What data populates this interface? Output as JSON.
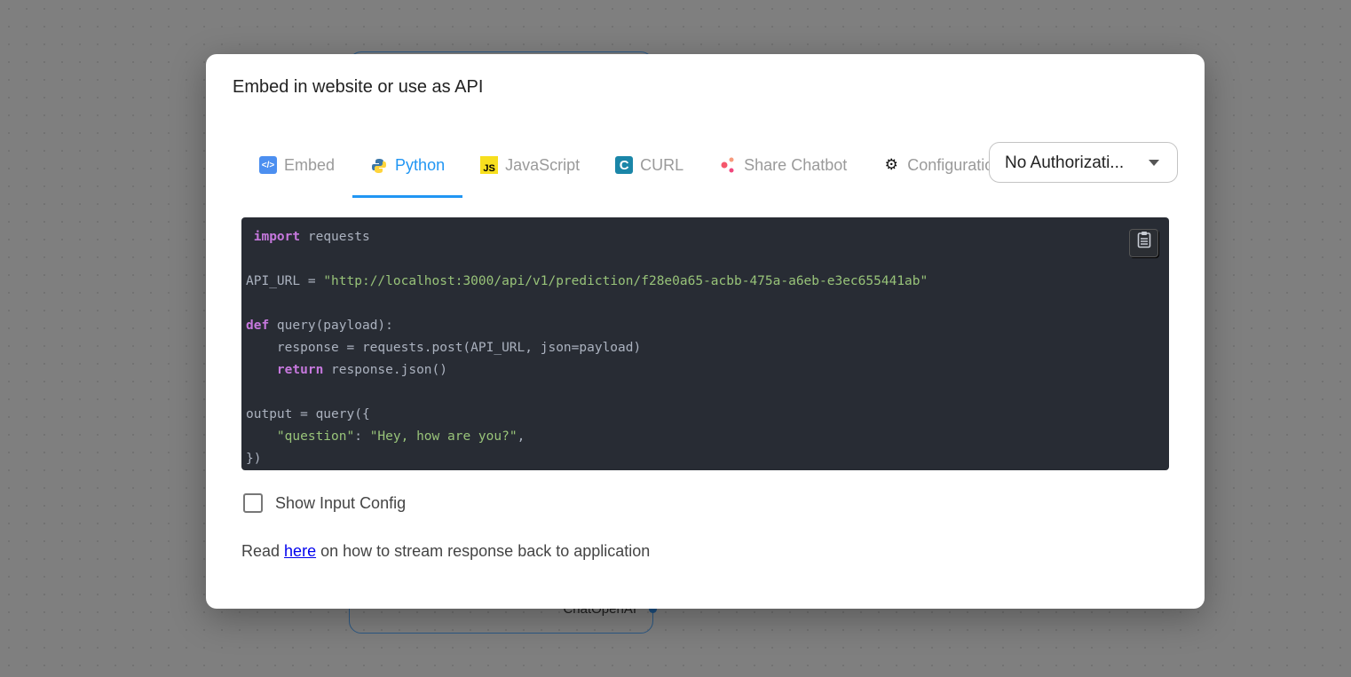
{
  "background": {
    "node_label": "ChatOpenAI"
  },
  "modal": {
    "title": "Embed in website or use as API",
    "tabs": [
      {
        "label": "Embed",
        "icon": "code-icon"
      },
      {
        "label": "Python",
        "icon": "python-icon"
      },
      {
        "label": "JavaScript",
        "icon": "js-icon"
      },
      {
        "label": "CURL",
        "icon": "curl-icon"
      },
      {
        "label": "Share Chatbot",
        "icon": "share-icon"
      },
      {
        "label": "Configuration",
        "icon": "gear-icon"
      }
    ],
    "active_tab": "Python",
    "auth_select": "No Authorizati...",
    "code": {
      "l1a": "import",
      "l1b": " requests",
      "l3a": "API_URL = ",
      "l3b": "\"http://localhost:3000/api/v1/prediction/f28e0a65-acbb-475a-a6eb-e3ec655441ab\"",
      "l5a": "def",
      "l5b": " query(payload):",
      "l6": "    response = requests.post(API_URL, json=payload)",
      "l7a": "    return",
      "l7b": " response.json()",
      "l9": "output = query({",
      "l10a": "    \"question\"",
      "l10b": ": ",
      "l10c": "\"Hey, how are you?\"",
      "l10d": ",",
      "l11": "})"
    },
    "show_input_config": {
      "label": "Show Input Config",
      "checked": false
    },
    "read": {
      "prefix": "Read ",
      "link": "here",
      "suffix": " on how to stream response back to application"
    }
  }
}
